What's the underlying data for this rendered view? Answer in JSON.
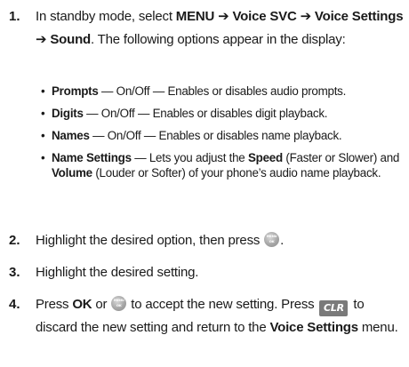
{
  "steps": [
    {
      "num": "1.",
      "t1": "In standby mode, select ",
      "menu": "MENU",
      "arrow1": " ➔ ",
      "voice_svc": "Voice SVC",
      "arrow2": " ➔ ",
      "voice_settings": "Voice Settings",
      "arrow3": " ➔ ",
      "sound": "Sound",
      "t2": ". The following options appear in the display:"
    },
    {
      "num": "2.",
      "text": "Highlight the desired option, then press "
    },
    {
      "num": "3.",
      "text": "Highlight the desired setting."
    },
    {
      "num": "4.",
      "t1": "Press ",
      "ok": "OK",
      "t2": " or ",
      "t3": " to accept the new setting. Press ",
      "t4": " to discard the new setting and return to the ",
      "voice_settings": "Voice Settings",
      "t5": " menu."
    }
  ],
  "bullets": [
    {
      "term": "Prompts",
      "desc": " — On/Off — Enables or disables audio prompts."
    },
    {
      "term": "Digits",
      "desc": " — On/Off — Enables or disables digit playback."
    },
    {
      "term": "Names",
      "desc": " — On/Off — Enables or disables name playback."
    },
    {
      "term": "Name Settings",
      "d1": " — Lets you adjust the ",
      "speed": "Speed",
      "d2": " (Faster or Slower) and ",
      "volume": "Volume",
      "d3": " (Louder or Softer) of your phone’s audio name playback."
    }
  ],
  "keys": {
    "menu_ok_line1": "MENU",
    "menu_ok_line2": "OK",
    "clr": "CLR",
    "menu_ok_icon": "menu-ok-key-icon",
    "clr_icon": "clr-key-icon"
  },
  "bullet_char": "•",
  "period": "."
}
